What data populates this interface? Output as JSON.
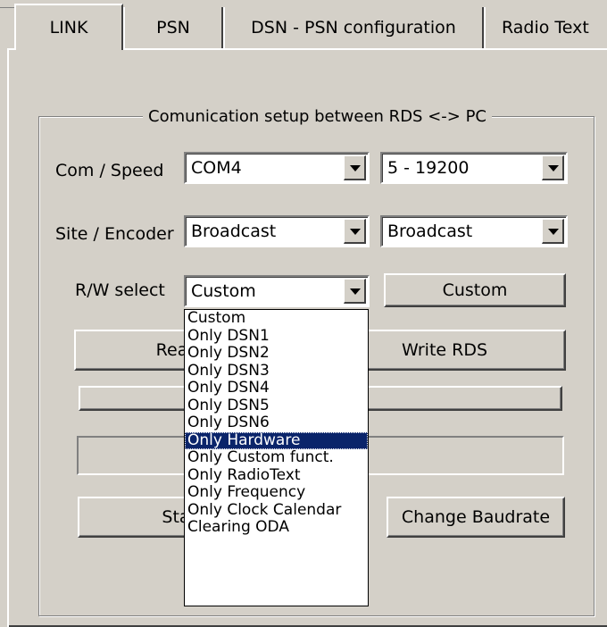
{
  "tabs": [
    "LINK",
    "PSN",
    "DSN - PSN configuration",
    "Radio Text"
  ],
  "group": {
    "title": "Comunication setup between RDS <-> PC",
    "com_label": "Com / Speed",
    "com_value": "COM4",
    "speed_value": "5 - 19200",
    "site_label": "Site / Encoder",
    "site_value": "Broadcast",
    "encoder_value": "Broadcast",
    "rw_label": "R/W select",
    "rw_value": "Custom",
    "rw_button": "Custom",
    "read_button": "Read RDS",
    "write_button": "Write RDS",
    "standby_button": "Stand-By / On",
    "baud_button": "Change Baudrate"
  },
  "dropdown": {
    "options": [
      "Custom",
      "Only DSN1",
      "Only DSN2",
      "Only DSN3",
      "Only DSN4",
      "Only DSN5",
      "Only DSN6",
      "Only Hardware",
      "Only Custom funct.",
      "Only RadioText",
      "Only Frequency",
      "Only Clock Calendar",
      "Clearing ODA"
    ],
    "selected": "Only Hardware"
  },
  "colors": {
    "face": "#d4d0c8",
    "highlight": "#0a246a"
  }
}
